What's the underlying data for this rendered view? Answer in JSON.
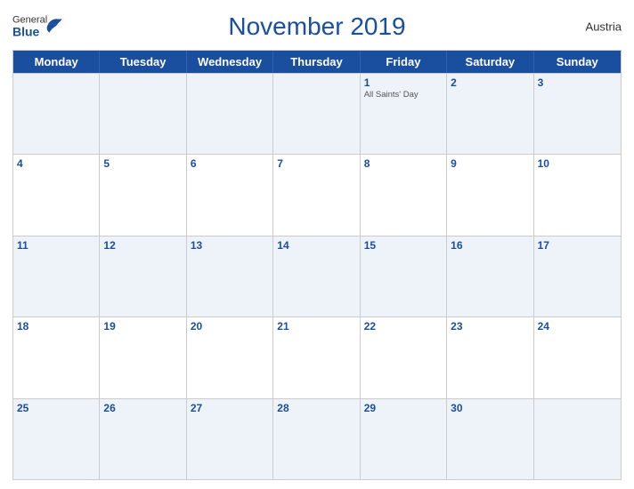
{
  "header": {
    "title": "November 2019",
    "country": "Austria",
    "logo": {
      "general": "General",
      "blue": "Blue"
    }
  },
  "dayHeaders": [
    "Monday",
    "Tuesday",
    "Wednesday",
    "Thursday",
    "Friday",
    "Saturday",
    "Sunday"
  ],
  "weeks": [
    [
      {
        "date": "",
        "events": []
      },
      {
        "date": "",
        "events": []
      },
      {
        "date": "",
        "events": []
      },
      {
        "date": "",
        "events": []
      },
      {
        "date": "1",
        "events": [
          "All Saints' Day"
        ]
      },
      {
        "date": "2",
        "events": []
      },
      {
        "date": "3",
        "events": []
      }
    ],
    [
      {
        "date": "4",
        "events": []
      },
      {
        "date": "5",
        "events": []
      },
      {
        "date": "6",
        "events": []
      },
      {
        "date": "7",
        "events": []
      },
      {
        "date": "8",
        "events": []
      },
      {
        "date": "9",
        "events": []
      },
      {
        "date": "10",
        "events": []
      }
    ],
    [
      {
        "date": "11",
        "events": []
      },
      {
        "date": "12",
        "events": []
      },
      {
        "date": "13",
        "events": []
      },
      {
        "date": "14",
        "events": []
      },
      {
        "date": "15",
        "events": []
      },
      {
        "date": "16",
        "events": []
      },
      {
        "date": "17",
        "events": []
      }
    ],
    [
      {
        "date": "18",
        "events": []
      },
      {
        "date": "19",
        "events": []
      },
      {
        "date": "20",
        "events": []
      },
      {
        "date": "21",
        "events": []
      },
      {
        "date": "22",
        "events": []
      },
      {
        "date": "23",
        "events": []
      },
      {
        "date": "24",
        "events": []
      }
    ],
    [
      {
        "date": "25",
        "events": []
      },
      {
        "date": "26",
        "events": []
      },
      {
        "date": "27",
        "events": []
      },
      {
        "date": "28",
        "events": []
      },
      {
        "date": "29",
        "events": []
      },
      {
        "date": "30",
        "events": []
      },
      {
        "date": "",
        "events": []
      }
    ]
  ]
}
